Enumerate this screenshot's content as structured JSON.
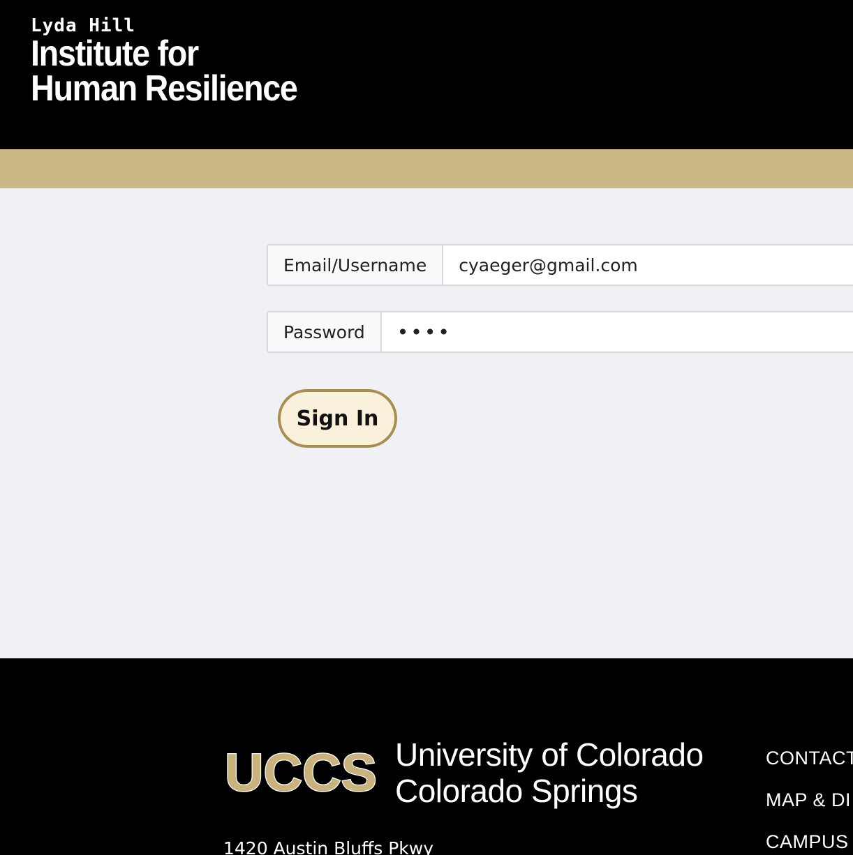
{
  "header": {
    "logo_line1": "Lyda Hill",
    "logo_line2": "Institute for",
    "logo_line3": "Human Resilience"
  },
  "colors": {
    "header_bg": "#000000",
    "gold_band": "#cbb885",
    "page_bg": "#f0f1f5",
    "button_border": "#a88f4e",
    "button_bg": "#f9f1dc"
  },
  "login": {
    "email_label": "Email/Username",
    "email_value": "cyaeger@gmail.com",
    "password_label": "Password",
    "password_value": "abcd",
    "signin_label": "Sign In"
  },
  "footer": {
    "uccs_mark": "UCCS",
    "university_line1": "University of Colorado",
    "university_line2": "Colorado Springs",
    "address": "1420 Austin Bluffs Pkwy",
    "links": [
      "CONTACT",
      "MAP & DI",
      "CAMPUS"
    ]
  }
}
